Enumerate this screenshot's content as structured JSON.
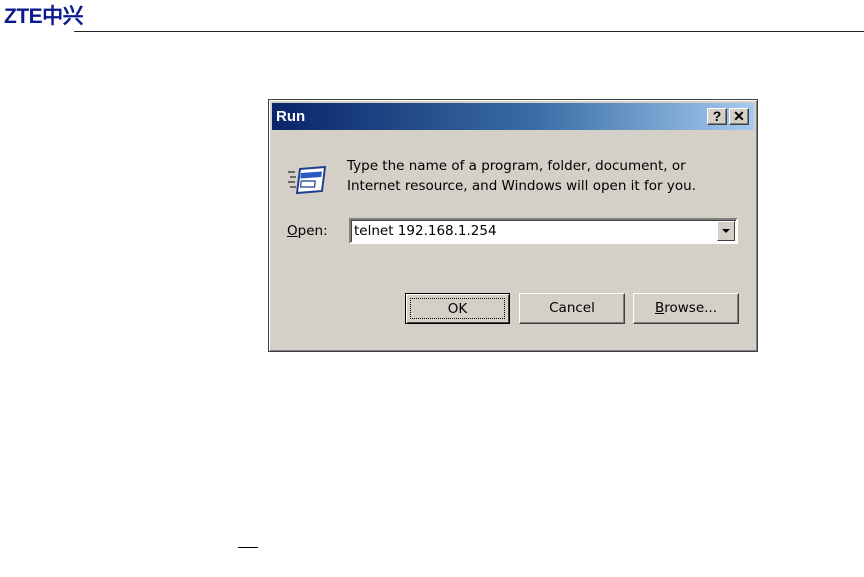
{
  "header": {
    "brand": "ZTE中兴"
  },
  "dialog": {
    "title": "Run",
    "help_button": "?",
    "close_button": "✕",
    "icon": "run-icon",
    "message_line1": "Type the name of a program, folder, document, or",
    "message_line2": "Internet resource, and Windows will open it for you.",
    "open_label_accel": "O",
    "open_label_rest": "pen:",
    "open_value": "telnet 192.168.1.254",
    "ok_label": "OK",
    "cancel_label": "Cancel",
    "browse_label_accel": "B",
    "browse_label_rest": "rowse..."
  }
}
